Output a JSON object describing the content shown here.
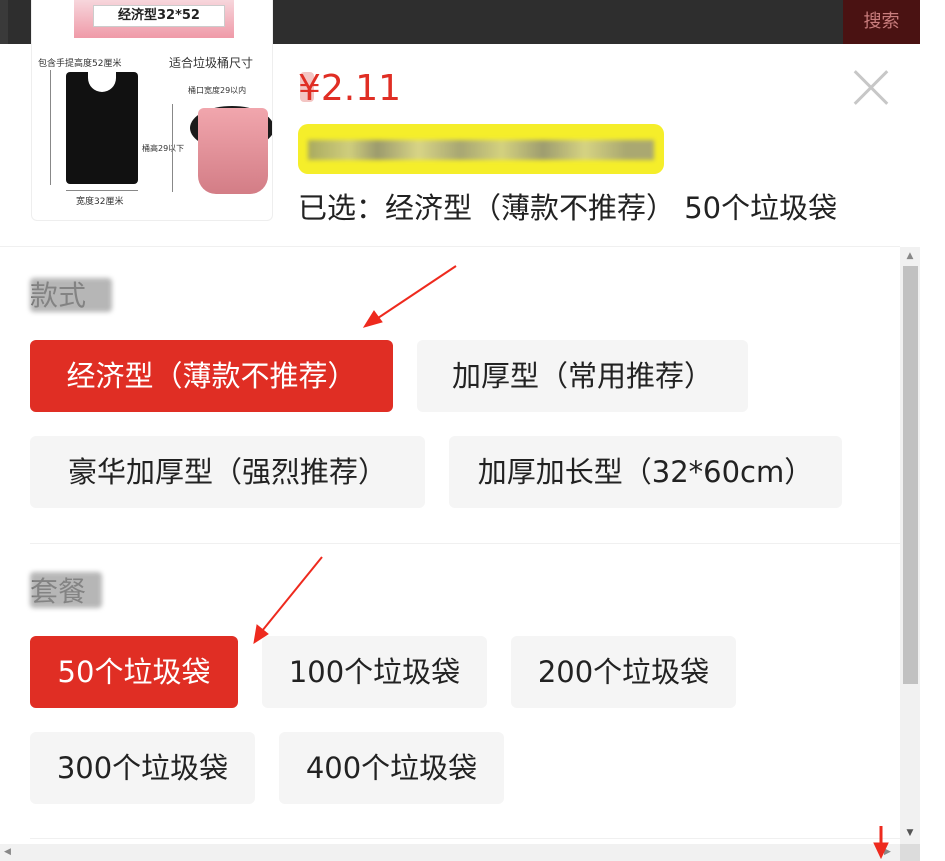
{
  "header": {
    "search_label": "搜索"
  },
  "product": {
    "badge": "经济型32*52",
    "thumb_labels": {
      "handle_height": "包含手提高度52厘米",
      "fits_bin": "适合垃圾桶尺寸",
      "mouth_width": "桶口宽度29以内",
      "bin_height": "桶高29以下",
      "width": "宽度32厘米"
    },
    "price": "¥2.11",
    "selected": "已选：经济型（薄款不推荐） 50个垃圾袋"
  },
  "sections": [
    {
      "label": "款式",
      "options": [
        {
          "label": "经济型（薄款不推荐）",
          "selected": true
        },
        {
          "label": "加厚型（常用推荐）",
          "selected": false
        },
        {
          "label": "豪华加厚型（强烈推荐）",
          "selected": false
        },
        {
          "label": "加厚加长型（32*60cm）",
          "selected": false
        }
      ]
    },
    {
      "label": "套餐",
      "options": [
        {
          "label": "50个垃圾袋",
          "selected": true
        },
        {
          "label": "100个垃圾袋",
          "selected": false
        },
        {
          "label": "200个垃圾袋",
          "selected": false
        },
        {
          "label": "300个垃圾袋",
          "selected": false
        },
        {
          "label": "400个垃圾袋",
          "selected": false
        }
      ]
    }
  ],
  "colors": {
    "accent": "#e02e24",
    "option_bg": "#f5f5f5",
    "stock_highlight": "#f5ee2a",
    "annotation_arrow": "#ee2a1e"
  },
  "icons": [
    "close-icon",
    "arrow-annotation-icon",
    "scroll-up-icon",
    "scroll-down-icon"
  ]
}
